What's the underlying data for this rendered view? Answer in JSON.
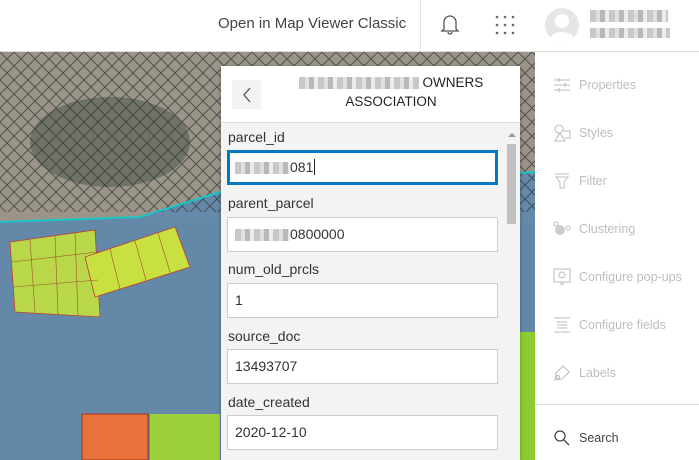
{
  "topbar": {
    "open_classic": "Open in Map Viewer Classic",
    "bell_icon": "bell-icon",
    "apps_icon": "apps-grid-icon"
  },
  "panel": {
    "title_suffix": "OWNERS",
    "title_line2": "ASSOCIATION",
    "fields": [
      {
        "label": "parcel_id",
        "value_suffix": "081"
      },
      {
        "label": "parent_parcel",
        "value_suffix": "0800000"
      },
      {
        "label": "num_old_prcls",
        "value": "1"
      },
      {
        "label": "source_doc",
        "value": "13493707"
      },
      {
        "label": "date_created",
        "value": "2020-12-10"
      }
    ]
  },
  "sidebar": {
    "items": [
      "Properties",
      "Styles",
      "Filter",
      "Clustering",
      "Configure pop-ups",
      "Configure fields",
      "Labels"
    ],
    "search": "Search"
  }
}
